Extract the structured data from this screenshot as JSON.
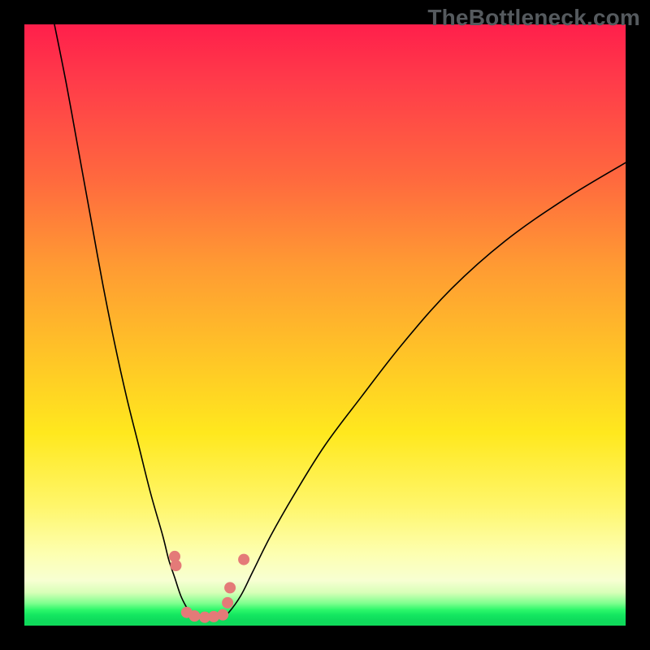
{
  "watermark": {
    "text": "TheBottleneck.com"
  },
  "chart_data": {
    "type": "line",
    "title": "",
    "xlabel": "",
    "ylabel": "",
    "xlim": [
      0,
      100
    ],
    "ylim": [
      0,
      100
    ],
    "grid": false,
    "legend": false,
    "background_gradient": {
      "orientation": "vertical",
      "stops": [
        {
          "pos": 0,
          "color": "#ff1f4b"
        },
        {
          "pos": 26,
          "color": "#ff6a3e"
        },
        {
          "pos": 55,
          "color": "#ffc427"
        },
        {
          "pos": 80,
          "color": "#fff66a"
        },
        {
          "pos": 94,
          "color": "#d8ffb8"
        },
        {
          "pos": 100,
          "color": "#0fd95a"
        }
      ]
    },
    "series": [
      {
        "name": "left-branch",
        "comment": "Steep descending curve from top-left into the valley floor",
        "x": [
          5,
          7,
          9,
          11,
          13,
          15,
          17,
          19,
          21,
          23,
          24,
          25,
          26,
          27,
          28
        ],
        "y": [
          100,
          90,
          79,
          68,
          57,
          47,
          38,
          30,
          22,
          15,
          11,
          8,
          5,
          3,
          1.5
        ]
      },
      {
        "name": "valley-floor",
        "comment": "Flat green-zone segment at the bottom of the V",
        "x": [
          28,
          29,
          30,
          31,
          32,
          33,
          34
        ],
        "y": [
          1.5,
          1.2,
          1.1,
          1.1,
          1.2,
          1.5,
          2.2
        ]
      },
      {
        "name": "right-branch",
        "comment": "Curve rising out of the valley and flattening toward the right edge",
        "x": [
          34,
          36,
          38,
          41,
          45,
          50,
          56,
          63,
          71,
          80,
          90,
          100
        ],
        "y": [
          2.2,
          5,
          9,
          15,
          22,
          30,
          38,
          47,
          56,
          64,
          71,
          77
        ]
      }
    ],
    "markers": {
      "comment": "Salmon dots near valley, values estimated from pixel positions",
      "color": "#e47a78",
      "points": [
        {
          "x": 25.0,
          "y": 11.5
        },
        {
          "x": 25.2,
          "y": 10.0
        },
        {
          "x": 27.0,
          "y": 2.2
        },
        {
          "x": 28.3,
          "y": 1.6
        },
        {
          "x": 30.0,
          "y": 1.4
        },
        {
          "x": 31.5,
          "y": 1.5
        },
        {
          "x": 33.0,
          "y": 1.8
        },
        {
          "x": 33.8,
          "y": 3.8
        },
        {
          "x": 34.2,
          "y": 6.3
        },
        {
          "x": 36.5,
          "y": 11.0
        }
      ]
    }
  }
}
